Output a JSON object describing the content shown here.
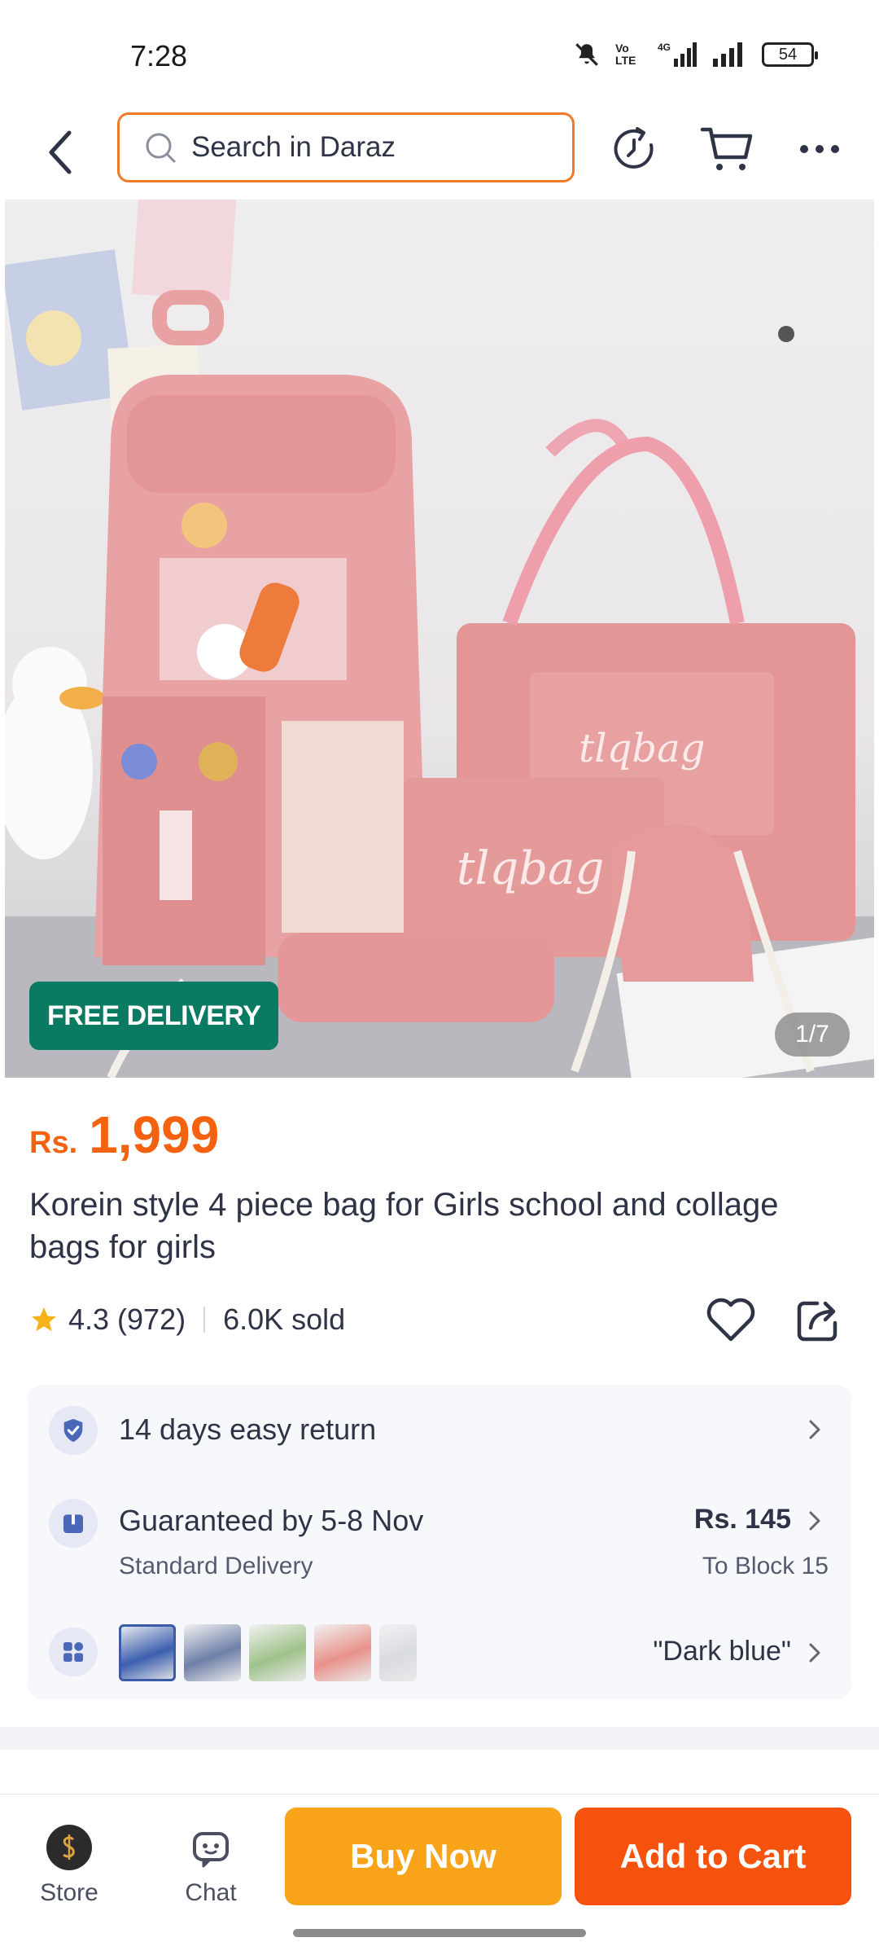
{
  "status_bar": {
    "time": "7:28",
    "battery": "54",
    "network": "4G",
    "volte": "Vo LTE"
  },
  "header": {
    "search_placeholder": "Search in Daraz"
  },
  "product": {
    "image_caption_brand": "tlqbag",
    "free_delivery_badge": "FREE DELIVERY",
    "image_counter": "1/7",
    "price_currency": "Rs.",
    "price_value": "1,999",
    "title": "Korein style 4 piece bag for Girls school and collage bags for girls",
    "rating": "4.3",
    "rating_count": "(972)",
    "sold": "6.0K sold"
  },
  "info_card": {
    "return_text": "14 days easy return",
    "delivery_guarantee": "Guaranteed by 5-8 Nov",
    "delivery_type": "Standard Delivery",
    "delivery_fee": "Rs. 145",
    "delivery_location": "To Block 15",
    "variant_selected": "\"Dark blue\"",
    "swatch_colors": [
      "#3c5fae",
      "#6e7fa8",
      "#9fc28a",
      "#e8928a",
      "#d8dbe0"
    ]
  },
  "bottom_bar": {
    "store_label": "Store",
    "chat_label": "Chat",
    "buy_now_label": "Buy Now",
    "add_to_cart_label": "Add to Cart"
  },
  "colors": {
    "accent_orange": "#f5620f",
    "buy_now": "#f9a31b",
    "add_to_cart": "#f5530d",
    "free_delivery_green": "#0b7a62",
    "search_border": "#ef7a28"
  }
}
